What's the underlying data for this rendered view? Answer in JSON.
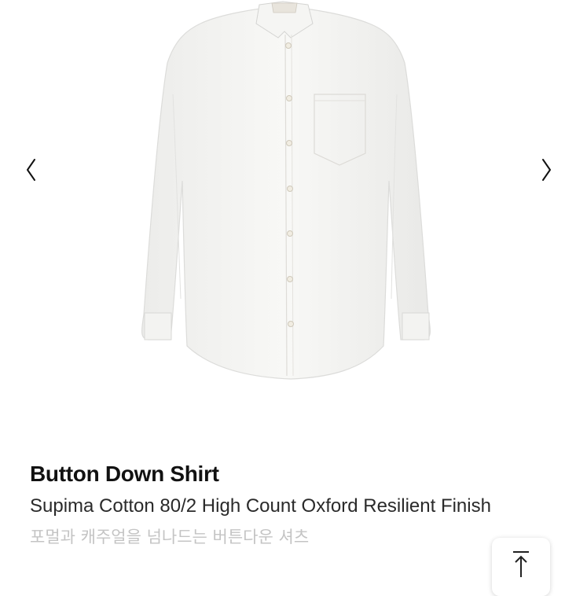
{
  "gallery": {
    "prev_icon": "chevron-left-icon",
    "next_icon": "chevron-right-icon",
    "image_subject": "white button down shirt"
  },
  "product": {
    "name": "Button Down Shirt",
    "description": "Supima Cotton 80/2 High Count Oxford Resilient Finish",
    "korean_description": "포멀과 캐주얼을 넘나드는 버튼다운 셔츠"
  },
  "scroll_top": {
    "icon": "arrow-up-to-top-icon"
  },
  "colors": {
    "title": "#111111",
    "subtitle": "#2a2a2a",
    "korean": "#c4c4c4",
    "background": "#ffffff"
  }
}
